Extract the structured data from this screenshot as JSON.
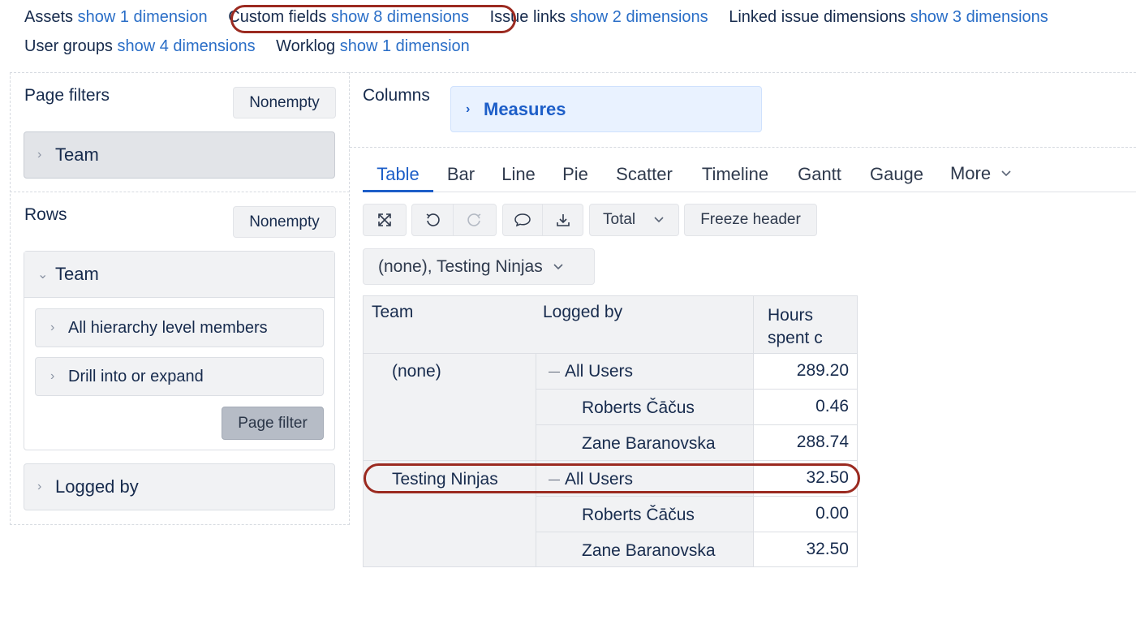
{
  "dimensions": {
    "row1": [
      {
        "name": "Assets",
        "link": "show 1 dimension"
      },
      {
        "name": "Custom fields",
        "link": "show 8 dimensions"
      },
      {
        "name": "Issue links",
        "link": "show 2 dimensions"
      },
      {
        "name": "Linked issue dimensions",
        "link": "show 3 dimensions"
      }
    ],
    "row2": [
      {
        "name": "User groups",
        "link": "show 4 dimensions"
      },
      {
        "name": "Worklog",
        "link": "show 1 dimension"
      }
    ]
  },
  "page_filters": {
    "title": "Page filters",
    "nonempty_label": "Nonempty",
    "items": [
      {
        "label": "Team"
      }
    ]
  },
  "rows": {
    "title": "Rows",
    "nonempty_label": "Nonempty",
    "expanded": {
      "label": "Team",
      "options": [
        {
          "label": "All hierarchy level members"
        },
        {
          "label": "Drill into or expand"
        }
      ],
      "page_filter_label": "Page filter"
    },
    "collapsed": {
      "label": "Logged by"
    }
  },
  "columns": {
    "title": "Columns",
    "measures_label": "Measures"
  },
  "tabs": {
    "items": [
      {
        "label": "Table",
        "active": true
      },
      {
        "label": "Bar"
      },
      {
        "label": "Line"
      },
      {
        "label": "Pie"
      },
      {
        "label": "Scatter"
      },
      {
        "label": "Timeline"
      },
      {
        "label": "Gantt"
      },
      {
        "label": "Gauge"
      }
    ],
    "more_label": "More"
  },
  "toolbar": {
    "icons": [
      "fullscreen-icon",
      "undo-icon",
      "redo-icon",
      "comment-icon",
      "download-icon"
    ],
    "total_label": "Total",
    "freeze_label": "Freeze header"
  },
  "filter_dropdown": {
    "value": "(none), Testing Ninjas"
  },
  "table": {
    "headers": {
      "team": "Team",
      "logged_by": "Logged by",
      "measure_line1": "Hours",
      "measure_line2": "spent c"
    },
    "groups": [
      {
        "team": "(none)",
        "rows": [
          {
            "user": "All Users",
            "value": "289.20",
            "total": true
          },
          {
            "user": "Roberts Čāčus",
            "value": "0.46"
          },
          {
            "user": "Zane Baranovska",
            "value": "288.74"
          }
        ]
      },
      {
        "team": "Testing Ninjas",
        "rows": [
          {
            "user": "All Users",
            "value": "32.50",
            "total": true
          },
          {
            "user": "Roberts Čāčus",
            "value": "0.00"
          },
          {
            "user": "Zane Baranovska",
            "value": "32.50"
          }
        ]
      }
    ]
  },
  "colors": {
    "link": "#2a6ec7",
    "active_tab": "#1d5ec8",
    "highlight_oval": "#9b2a20",
    "measures_bg": "#e9f2ff"
  }
}
